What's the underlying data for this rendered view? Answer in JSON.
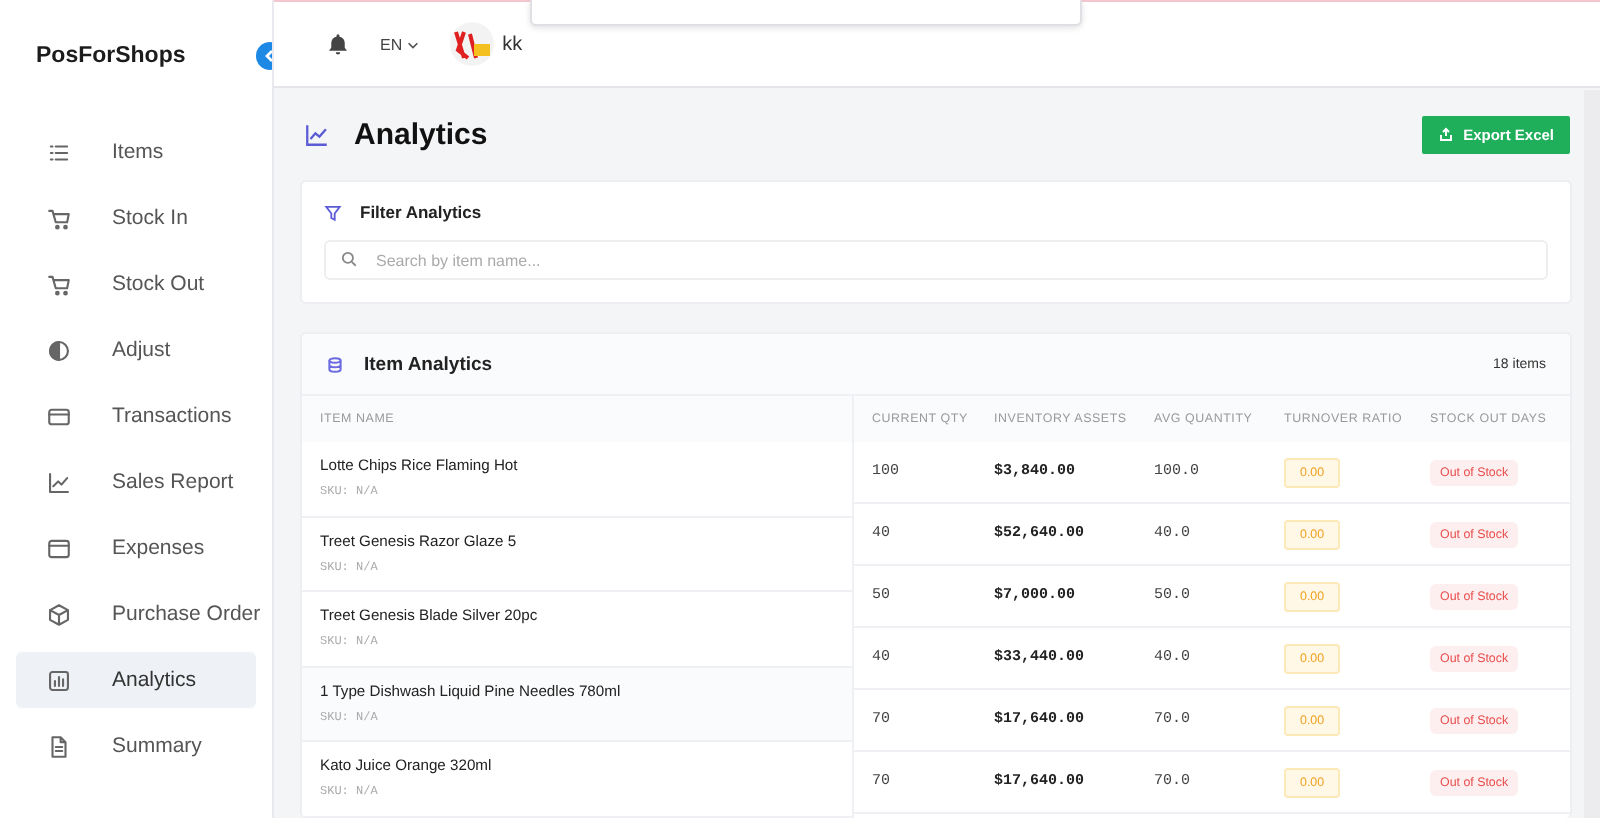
{
  "brand": "PosForShops",
  "sidebar": {
    "items": [
      {
        "label": "Items",
        "selected": false
      },
      {
        "label": "Stock In",
        "selected": false
      },
      {
        "label": "Stock Out",
        "selected": false
      },
      {
        "label": "Adjust",
        "selected": false
      },
      {
        "label": "Transactions",
        "selected": false
      },
      {
        "label": "Sales Report",
        "selected": false
      },
      {
        "label": "Expenses",
        "selected": false
      },
      {
        "label": "Purchase Order",
        "selected": false
      },
      {
        "label": "Analytics",
        "selected": true
      },
      {
        "label": "Summary",
        "selected": false
      }
    ]
  },
  "header": {
    "language": "EN",
    "user": "kk"
  },
  "page": {
    "title": "Analytics",
    "export_button": "Export Excel"
  },
  "filter": {
    "title": "Filter Analytics",
    "search": {
      "placeholder": "Search by item name..."
    }
  },
  "table": {
    "title": "Item Analytics",
    "count": "18 items",
    "columns": [
      "ITEM NAME",
      "CURRENT QTY",
      "INVENTORY ASSETS",
      "AVG QUANTITY",
      "TURNOVER RATIO",
      "STOCK OUT DAYS"
    ],
    "names": [
      {
        "name": "Lotte Chips Rice Flaming Hot",
        "sku": "SKU: N/A"
      },
      {
        "name": "Treet Genesis Razor Glaze 5",
        "sku": "SKU: N/A"
      },
      {
        "name": "Treet Genesis Blade Silver 20pc",
        "sku": "SKU: N/A"
      },
      {
        "name": "1 Type Dishwash Liquid Pine Needles 780ml",
        "sku": "SKU: N/A"
      },
      {
        "name": "Kato Juice Orange 320ml",
        "sku": "SKU: N/A"
      }
    ],
    "rows": [
      {
        "qty": "100",
        "assets": "$3,840.00",
        "avg": "100.0",
        "turnover": "0.00",
        "stock_out": "Out of Stock"
      },
      {
        "qty": "40",
        "assets": "$52,640.00",
        "avg": "40.0",
        "turnover": "0.00",
        "stock_out": "Out of Stock"
      },
      {
        "qty": "50",
        "assets": "$7,000.00",
        "avg": "50.0",
        "turnover": "0.00",
        "stock_out": "Out of Stock"
      },
      {
        "qty": "40",
        "assets": "$33,440.00",
        "avg": "40.0",
        "turnover": "0.00",
        "stock_out": "Out of Stock"
      },
      {
        "qty": "70",
        "assets": "$17,640.00",
        "avg": "70.0",
        "turnover": "0.00",
        "stock_out": "Out of Stock"
      },
      {
        "qty": "70",
        "assets": "$17,640.00",
        "avg": "70.0",
        "turnover": "0.00",
        "stock_out": "Out of Stock"
      }
    ]
  }
}
